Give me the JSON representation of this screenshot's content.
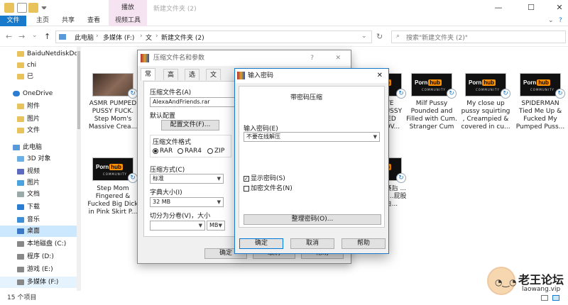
{
  "window": {
    "title": "新建文件夹 (2)",
    "tool_tab_head": "播放",
    "controls": {
      "minimize": "—",
      "maximize": "☐",
      "close": "✕"
    }
  },
  "ribbon": {
    "tabs": [
      "文件",
      "主页",
      "共享",
      "查看",
      "视频工具"
    ],
    "collapse": "⌄",
    "help": "?"
  },
  "address": {
    "back": "←",
    "forward": "→",
    "dropdown": "⌄",
    "up": "↑",
    "crumbs": [
      "此电脑",
      "多媒体 (F:)",
      "文",
      "新建文件夹 (2)"
    ],
    "refresh": "↻",
    "search_placeholder": "搜索\"新建文件夹 (2)\""
  },
  "sidebar": {
    "items": [
      {
        "label": "BaiduNetdiskDo",
        "icon": "folder-icon"
      },
      {
        "label": "chi",
        "icon": "folder-icon"
      },
      {
        "label": "已",
        "icon": "folder-icon"
      },
      {
        "label": "OneDrive",
        "icon": "cloud-icon"
      },
      {
        "label": "附件",
        "icon": "folder-icon"
      },
      {
        "label": "图片",
        "icon": "folder-icon"
      },
      {
        "label": "文件",
        "icon": "folder-icon"
      },
      {
        "label": "此电脑",
        "icon": "computer-icon"
      },
      {
        "label": "3D 对象",
        "icon": "cube-icon"
      },
      {
        "label": "视频",
        "icon": "video-icon"
      },
      {
        "label": "图片",
        "icon": "picture-icon"
      },
      {
        "label": "文档",
        "icon": "document-icon"
      },
      {
        "label": "下载",
        "icon": "download-icon"
      },
      {
        "label": "音乐",
        "icon": "music-icon"
      },
      {
        "label": "桌面",
        "icon": "desktop-icon"
      },
      {
        "label": "本地磁盘 (C:)",
        "icon": "drive-icon"
      },
      {
        "label": "程序 (D:)",
        "icon": "drive-icon"
      },
      {
        "label": "游戏 (E:)",
        "icon": "drive-icon"
      },
      {
        "label": "多媒体 (F:)",
        "icon": "drive-icon"
      }
    ]
  },
  "files": [
    {
      "name": "ASMR PUMPED PUSSY FUCK. Step Mom's Massive Crea..."
    },
    {
      "name": "...VE ...USSY ...IED ...OV..."
    },
    {
      "name": "Milf Pussy Pounded and Filled with Cum. Stranger Cum ..."
    },
    {
      "name": "My close up pussy squirting , Creampied & covered in cu..."
    },
    {
      "name": "SPIDERMAN Tied Me Up & Fucked My Pumped Puss..."
    },
    {
      "name": "Step Mom Fingered & Fucked Big Dick in Pink Skirt P..."
    },
    {
      "name": "...赛后 ...后 ...屁股 ...白..."
    }
  ],
  "thumb_logo": {
    "porn": "Porn",
    "hub": "hub",
    "sub": "COMMUNITY"
  },
  "status": {
    "count": "15 个项目"
  },
  "archive_dialog": {
    "title": "压缩文件名和参数",
    "help": "?",
    "close": "✕",
    "tabs": [
      "常规",
      "高级",
      "选项",
      "文件"
    ],
    "archive_name_label": "压缩文件名(A)",
    "archive_name_value": "AlexaAndFriends.rar",
    "profile_label": "默认配置",
    "profile_button": "配置文件(F)...",
    "format_label": "压缩文件格式",
    "formats": [
      "RAR",
      "RAR4",
      "ZIP"
    ],
    "method_label": "压缩方式(C)",
    "method_value": "标准",
    "dict_label": "字典大小(I)",
    "dict_value": "32 MB",
    "split_label": "切分为分卷(V)，大小",
    "split_unit": "MB",
    "ok": "确定",
    "cancel": "取消",
    "help_button": "帮助"
  },
  "password_dialog": {
    "title": "输入密码",
    "close": "✕",
    "heading": "带密码压缩",
    "enter_label": "输入密码(E)",
    "enter_value": "不要在线解压",
    "show_password": "显示密码(S)",
    "show_password_checked": true,
    "encrypt_names": "加密文件名(N)",
    "encrypt_names_checked": false,
    "organize_button": "整理密码(O)...",
    "ok": "确定",
    "cancel": "取消",
    "help": "帮助"
  },
  "watermark": {
    "title": "老王论坛",
    "url": "laowang.vip",
    "face": "◔‿◔"
  },
  "colors": {
    "accent": "#1979ca",
    "tool_tab": "#f6e3f2",
    "selection": "#cce8ff"
  }
}
